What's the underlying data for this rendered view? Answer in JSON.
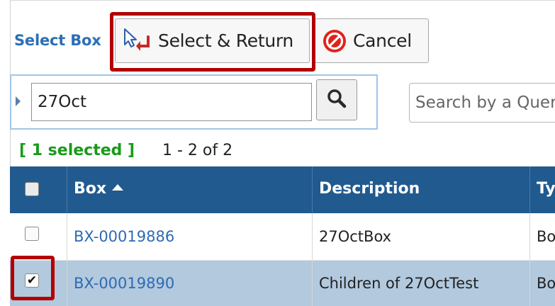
{
  "toolbar": {
    "label": "Select Box",
    "select_return_label": "Select & Return",
    "cancel_label": "Cancel"
  },
  "filter": {
    "value": "27Oct",
    "query_placeholder": "Search by a Query"
  },
  "selection": {
    "count_label": "[ 1 selected ]",
    "paging": "1 - 2 of 2"
  },
  "grid": {
    "columns": {
      "box": "Box",
      "description": "Description",
      "type": "Type"
    },
    "rows": [
      {
        "box": "BX-00019886",
        "description": "27OctBox",
        "type": "Box",
        "selected": false
      },
      {
        "box": "BX-00019890",
        "description": "Children of 27OctTest",
        "type": "Box",
        "selected": true
      }
    ]
  },
  "colors": {
    "header_bg": "#215a8f",
    "selected_row_bg": "#b2c9de",
    "link": "#2f6ab3",
    "highlight": "#b30000",
    "selected_count": "#1a9a1a"
  },
  "icons": {
    "select_return": "cursor-return-icon",
    "cancel": "cancel-icon",
    "search": "search-icon",
    "sort": "sort-ascending-icon",
    "expand": "caret-right-icon"
  }
}
